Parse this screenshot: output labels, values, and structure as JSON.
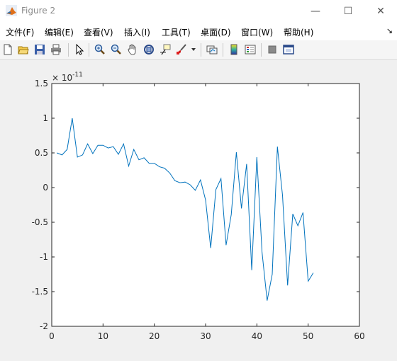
{
  "window": {
    "title": "Figure 2",
    "minimize_glyph": "—",
    "maximize_glyph": "☐",
    "close_glyph": "✕"
  },
  "menu": {
    "items": [
      "文件(F)",
      "编辑(E)",
      "查看(V)",
      "插入(I)",
      "工具(T)",
      "桌面(D)",
      "窗口(W)",
      "帮助(H)"
    ],
    "overflow_glyph": "↘"
  },
  "toolbar": {
    "buttons": [
      "new-figure-icon",
      "open-file-icon",
      "save-icon",
      "print-icon",
      "pointer-icon",
      "zoom-in-icon",
      "zoom-out-icon",
      "pan-hand-icon",
      "rotate-3d-icon",
      "data-cursor-icon",
      "brush-icon",
      "brush-dropdown-icon",
      "link-plot-icon",
      "colorbar-icon",
      "legend-icon",
      "hide-plot-tools-icon",
      "show-plot-tools-icon"
    ]
  },
  "chart_data": {
    "type": "line",
    "title": "",
    "xlabel": "",
    "ylabel": "",
    "exponent_label": "× 10^-11",
    "exponent_times": "×",
    "exponent_base": "10",
    "exponent_power": "-11",
    "xlim": [
      0,
      60
    ],
    "ylim": [
      -2,
      1.5
    ],
    "x_ticks": [
      "0",
      "10",
      "20",
      "30",
      "40",
      "50",
      "60"
    ],
    "y_ticks": [
      "-2",
      "-1.5",
      "-1",
      "-0.5",
      "0",
      "0.5",
      "1",
      "1.5"
    ],
    "line_color": "#0072bd",
    "grid": false,
    "series": [
      {
        "x": [
          1,
          2,
          3,
          4,
          5,
          6,
          7,
          8,
          9,
          10,
          11,
          12,
          13,
          14,
          15,
          16,
          17,
          18,
          19,
          20,
          21,
          22,
          23,
          24,
          25,
          26,
          27,
          28,
          29,
          30,
          31,
          32,
          33,
          34,
          35,
          36,
          37,
          38,
          39,
          40,
          41,
          42,
          43,
          44,
          45,
          46,
          47,
          48,
          49,
          50,
          51
        ],
        "values": [
          0.5,
          0.47,
          0.55,
          1.0,
          0.44,
          0.47,
          0.63,
          0.49,
          0.61,
          0.61,
          0.57,
          0.59,
          0.48,
          0.63,
          0.31,
          0.55,
          0.4,
          0.43,
          0.35,
          0.35,
          0.3,
          0.28,
          0.21,
          0.1,
          0.07,
          0.08,
          0.04,
          -0.04,
          0.11,
          -0.18,
          -0.87,
          -0.03,
          0.13,
          -0.83,
          -0.39,
          0.51,
          -0.3,
          0.34,
          -1.19,
          0.44,
          -0.93,
          -1.63,
          -1.25,
          0.59,
          -0.11,
          -1.41,
          -0.38,
          -0.55,
          -0.36,
          -1.35,
          -1.23
        ]
      }
    ]
  }
}
